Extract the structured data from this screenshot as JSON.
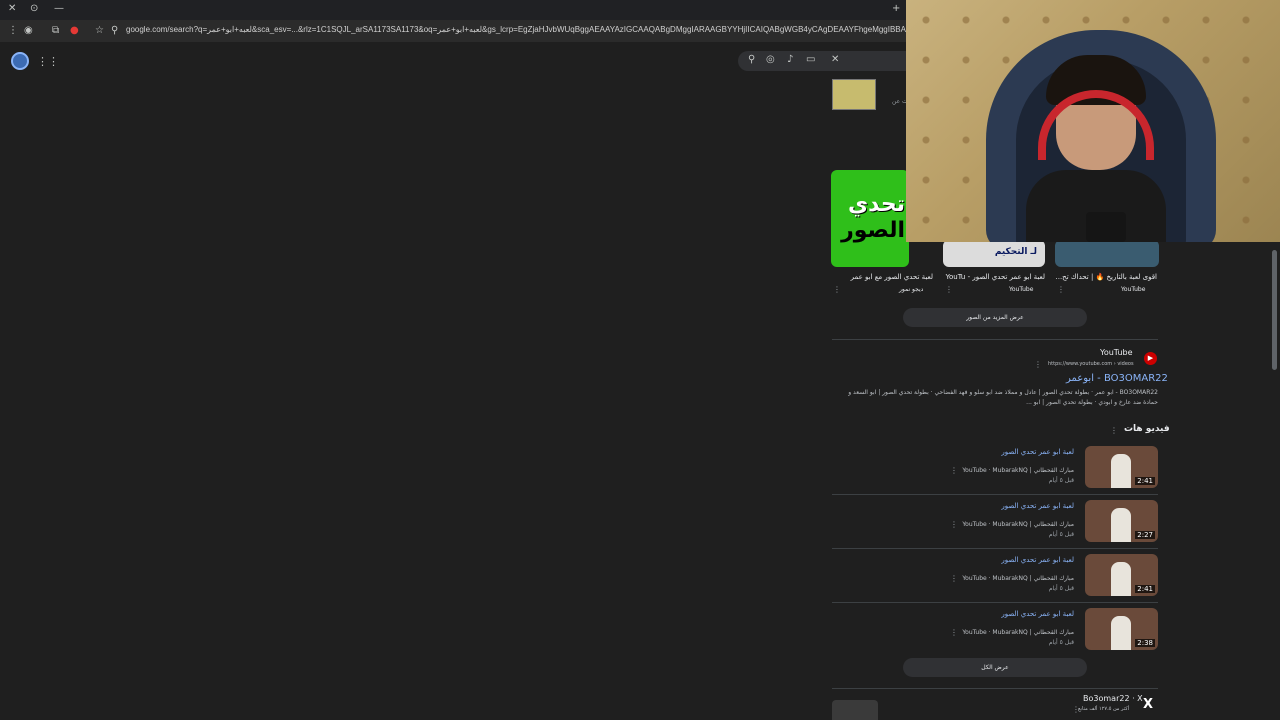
{
  "browser": {
    "url": "google.com/search?q=لعبه+ابو+عمر&sca_esv=...&rlz=1C1SQJL_arSA1173SA1173&oq=لعبه+ابو+عمر&gs_lcrp=EgZjaHJvbWUqBggAEAAYAzIGCAAQABgDMggIARAAGBYYHjIICAIQABgWGB4yCAgDEAAYFhgeMggIBBAAGBYYHjIICAUQABgWGB4yCAgGEAAYFhgeMggI"
  },
  "top_result": {
    "small_note": "ت عن"
  },
  "video_cards": [
    {
      "title": "لعبة تحدي الصور مع ابو عمر",
      "source": "ديجو نمور",
      "thumb_line1": "تحدي",
      "thumb_line2": "الصور"
    },
    {
      "title": "لعبة ابو عمر تحدي الصور - YouTu",
      "source": "YouTube",
      "thumb_text": "لـ التحكيم"
    },
    {
      "title": "اقوى لعبة بالتاريخ 🔥 | تحداك تح...",
      "source": "YouTube"
    }
  ],
  "more_images_btn": "عرض المزيد من الصور",
  "youtube_result": {
    "site": "YouTube",
    "url": "https://www.youtube.com › videos",
    "title": "BO3OMAR22 - ابوعمر",
    "desc": "BO3OMAR22 - ابو عمر · بطولة تحدي الصور | عادل و مملاذ ضد ابو سلو و فهد الفضاحي · بطولة تحدي الصور | ابو السعد و حمادة ضد عارخ و ابودي · بطولة تحدي الصور | ابو ..."
  },
  "videos_section": {
    "heading": "فيديو هات",
    "rows": [
      {
        "title": "لعبة ابو عمر تحدي الصور",
        "meta": "YouTube · MubarakNQ | مبارك القحطاني",
        "ago": "قبل ٥ أيام",
        "duration": "2:41"
      },
      {
        "title": "لعبة ابو عمر تحدي الصور",
        "meta": "YouTube · MubarakNQ | مبارك القحطاني",
        "ago": "قبل ٥ أيام",
        "duration": "2:27"
      },
      {
        "title": "لعبة ابو عمر تحدي الصور",
        "meta": "YouTube · MubarakNQ | مبارك القحطاني",
        "ago": "قبل ٥ أيام",
        "duration": "2:41"
      },
      {
        "title": "لعبة ابو عمر تحدي الصور",
        "meta": "YouTube · MubarakNQ | مبارك القحطاني",
        "ago": "قبل ٥ أيام",
        "duration": "2:38"
      }
    ],
    "view_all": "عرض الكل"
  },
  "x_result": {
    "title": "Bo3omar22 · X",
    "sub": "أكثر من ١٢٧،٥ ألف متابع"
  }
}
